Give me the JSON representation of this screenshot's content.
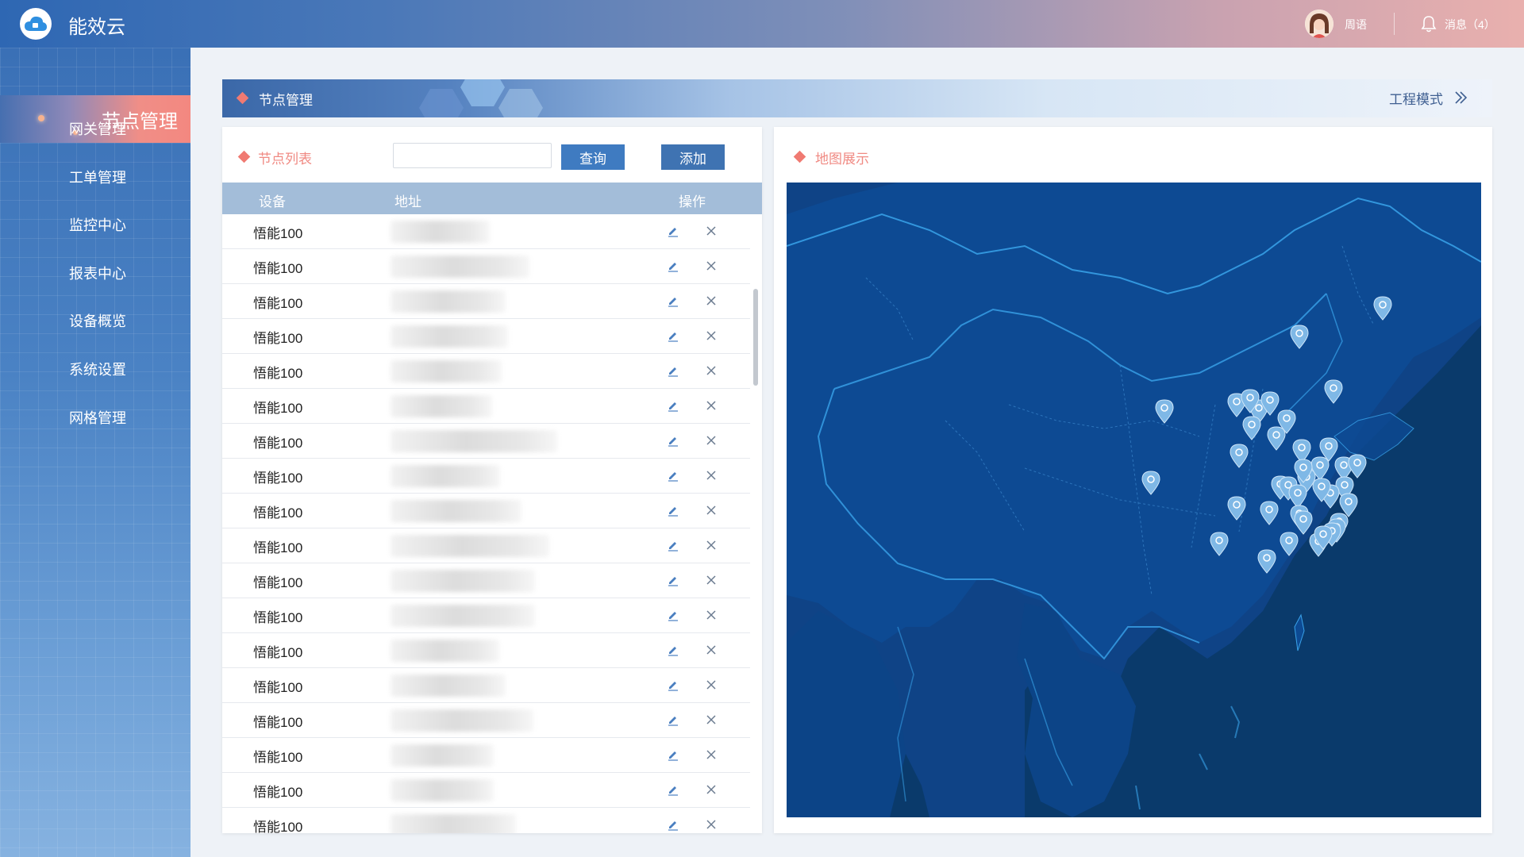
{
  "app": {
    "title": "能效云"
  },
  "user": {
    "name": "周语",
    "messages_label": "消息（4）"
  },
  "sidebar": {
    "active": "节点管理",
    "items": [
      {
        "label": "网关管理"
      },
      {
        "label": "工单管理"
      },
      {
        "label": "监控中心"
      },
      {
        "label": "报表中心"
      },
      {
        "label": "设备概览"
      },
      {
        "label": "系统设置"
      },
      {
        "label": "网格管理"
      }
    ]
  },
  "page": {
    "title": "节点管理",
    "mode_link": "工程模式"
  },
  "node_list": {
    "title": "节点列表",
    "search": {
      "value": "",
      "placeholder": ""
    },
    "query_label": "查询",
    "add_label": "添加",
    "columns": {
      "device": "设备",
      "address": "地址",
      "action": "操作"
    },
    "rows": [
      {
        "device": "悟能100"
      },
      {
        "device": "悟能100"
      },
      {
        "device": "悟能100"
      },
      {
        "device": "悟能100"
      },
      {
        "device": "悟能100"
      },
      {
        "device": "悟能100"
      },
      {
        "device": "悟能100"
      },
      {
        "device": "悟能100"
      },
      {
        "device": "悟能100"
      },
      {
        "device": "悟能100"
      },
      {
        "device": "悟能100"
      },
      {
        "device": "悟能100"
      },
      {
        "device": "悟能100"
      },
      {
        "device": "悟能100"
      },
      {
        "device": "悟能100"
      },
      {
        "device": "悟能100"
      },
      {
        "device": "悟能100"
      },
      {
        "device": "悟能100"
      }
    ]
  },
  "map_panel": {
    "title": "地图展示"
  },
  "colors": {
    "accent": "#f07a72",
    "primary": "#3f7bc1",
    "map_bg": "#0d3f7c",
    "marker": "#7fb8e6"
  },
  "icons": {
    "edit": "pencil-icon",
    "delete": "close-icon",
    "bell": "bell-icon",
    "chevron": "double-chevron-right-icon",
    "marker": "map-pin-icon"
  }
}
